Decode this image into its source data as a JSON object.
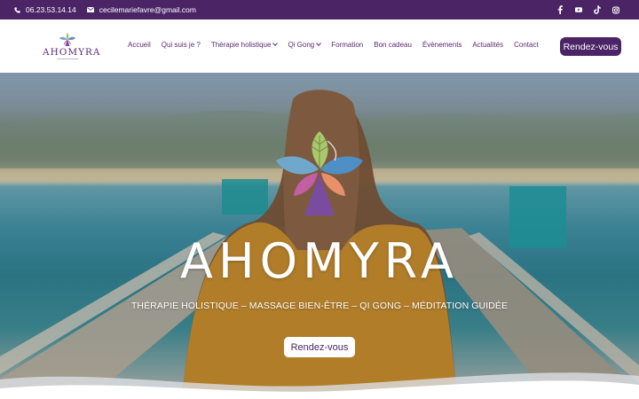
{
  "topbar": {
    "phone": "06.23.53.14.14",
    "email": "cecilemariefavre@gmail.com",
    "social": [
      "facebook-icon",
      "youtube-icon",
      "tiktok-icon",
      "instagram-icon"
    ]
  },
  "header": {
    "logo_text": "AHOMYRA",
    "nav": [
      {
        "label": "Accueil",
        "dropdown": false
      },
      {
        "label": "Qui suis je ?",
        "dropdown": false
      },
      {
        "label": "Thérapie holistique",
        "dropdown": true
      },
      {
        "label": "Qi Gong",
        "dropdown": true
      },
      {
        "label": "Formation",
        "dropdown": false
      },
      {
        "label": "Bon cadeau",
        "dropdown": false
      },
      {
        "label": "Évènements",
        "dropdown": false
      },
      {
        "label": "Actualités",
        "dropdown": false
      },
      {
        "label": "Contact",
        "dropdown": false
      }
    ],
    "cta_label": "Rendez-vous"
  },
  "hero": {
    "title": "AHOMYRA",
    "subtitle": "THÉRAPIE HOLISTIQUE – MASSAGE BIEN-ÊTRE – QI GONG – MÉDITATION GUIDÉE",
    "button_label": "Rendez-vous"
  },
  "colors": {
    "brand_purple": "#4b2466",
    "nav_text": "#5a2a74",
    "white": "#ffffff"
  }
}
